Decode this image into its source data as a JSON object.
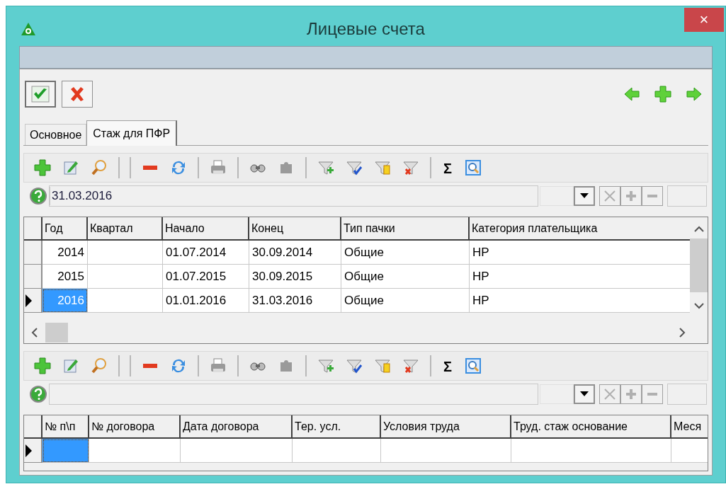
{
  "window": {
    "title": "Лицевые счета",
    "close": "×"
  },
  "tabs": [
    {
      "label": "Основное",
      "selected": false
    },
    {
      "label": "Стаж для ПФР",
      "selected": true
    }
  ],
  "grids": [
    {
      "sum_button": "Σ",
      "filter_value": "31.03.2016",
      "columns": [
        "Год",
        "Квартал",
        "Начало",
        "Конец",
        "Тип пачки",
        "Категория плательщика"
      ],
      "rows": [
        {
          "selected": false,
          "cells": [
            "2014",
            "",
            "01.07.2014",
            "30.09.2014",
            "Общие",
            "НР"
          ]
        },
        {
          "selected": false,
          "cells": [
            "2015",
            "",
            "01.07.2015",
            "30.09.2015",
            "Общие",
            "НР"
          ]
        },
        {
          "selected": true,
          "cells": [
            "2016",
            "",
            "01.01.2016",
            "31.03.2016",
            "Общие",
            "НР"
          ]
        }
      ]
    },
    {
      "sum_button": "Σ",
      "columns": [
        "№ п\\п",
        "№ договора",
        "Дата договора",
        "Тер. усл.",
        "Условия труда",
        "Труд. стаж основание",
        "Меся"
      ],
      "rows": [
        {
          "selected": true,
          "cells": [
            "",
            "",
            "",
            "",
            "",
            "",
            ""
          ]
        }
      ]
    }
  ]
}
